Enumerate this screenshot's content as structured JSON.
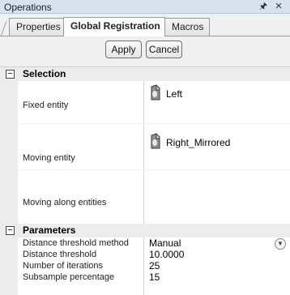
{
  "window": {
    "title": "Operations"
  },
  "tabs": [
    {
      "label": "Properties"
    },
    {
      "label": "Global Registration",
      "active": true
    },
    {
      "label": "Macros"
    }
  ],
  "buttons": {
    "apply": "Apply",
    "cancel": "Cancel"
  },
  "selection": {
    "header": "Selection",
    "toggle": "−",
    "fixed_label": "Fixed entity",
    "fixed_value": "Left",
    "moving_label": "Moving entity",
    "moving_value": "Right_Mirrored",
    "along_label": "Moving along entities",
    "along_value": ""
  },
  "parameters": {
    "header": "Parameters",
    "toggle": "−",
    "rows": [
      {
        "name": "Distance threshold method",
        "value": "Manual"
      },
      {
        "name": "Distance threshold",
        "value": "10.0000"
      },
      {
        "name": "Number of iterations",
        "value": "25"
      },
      {
        "name": "Subsample percentage",
        "value": "15"
      }
    ]
  },
  "icons": {
    "pin": "pin-icon",
    "close": "close-icon",
    "entity": "mesh-entity-icon",
    "dropdown": "chevron-down-icon"
  },
  "colors": {
    "titlebar": "#d8e2ef",
    "panel": "#f0f0f0",
    "category": "#ececec"
  }
}
